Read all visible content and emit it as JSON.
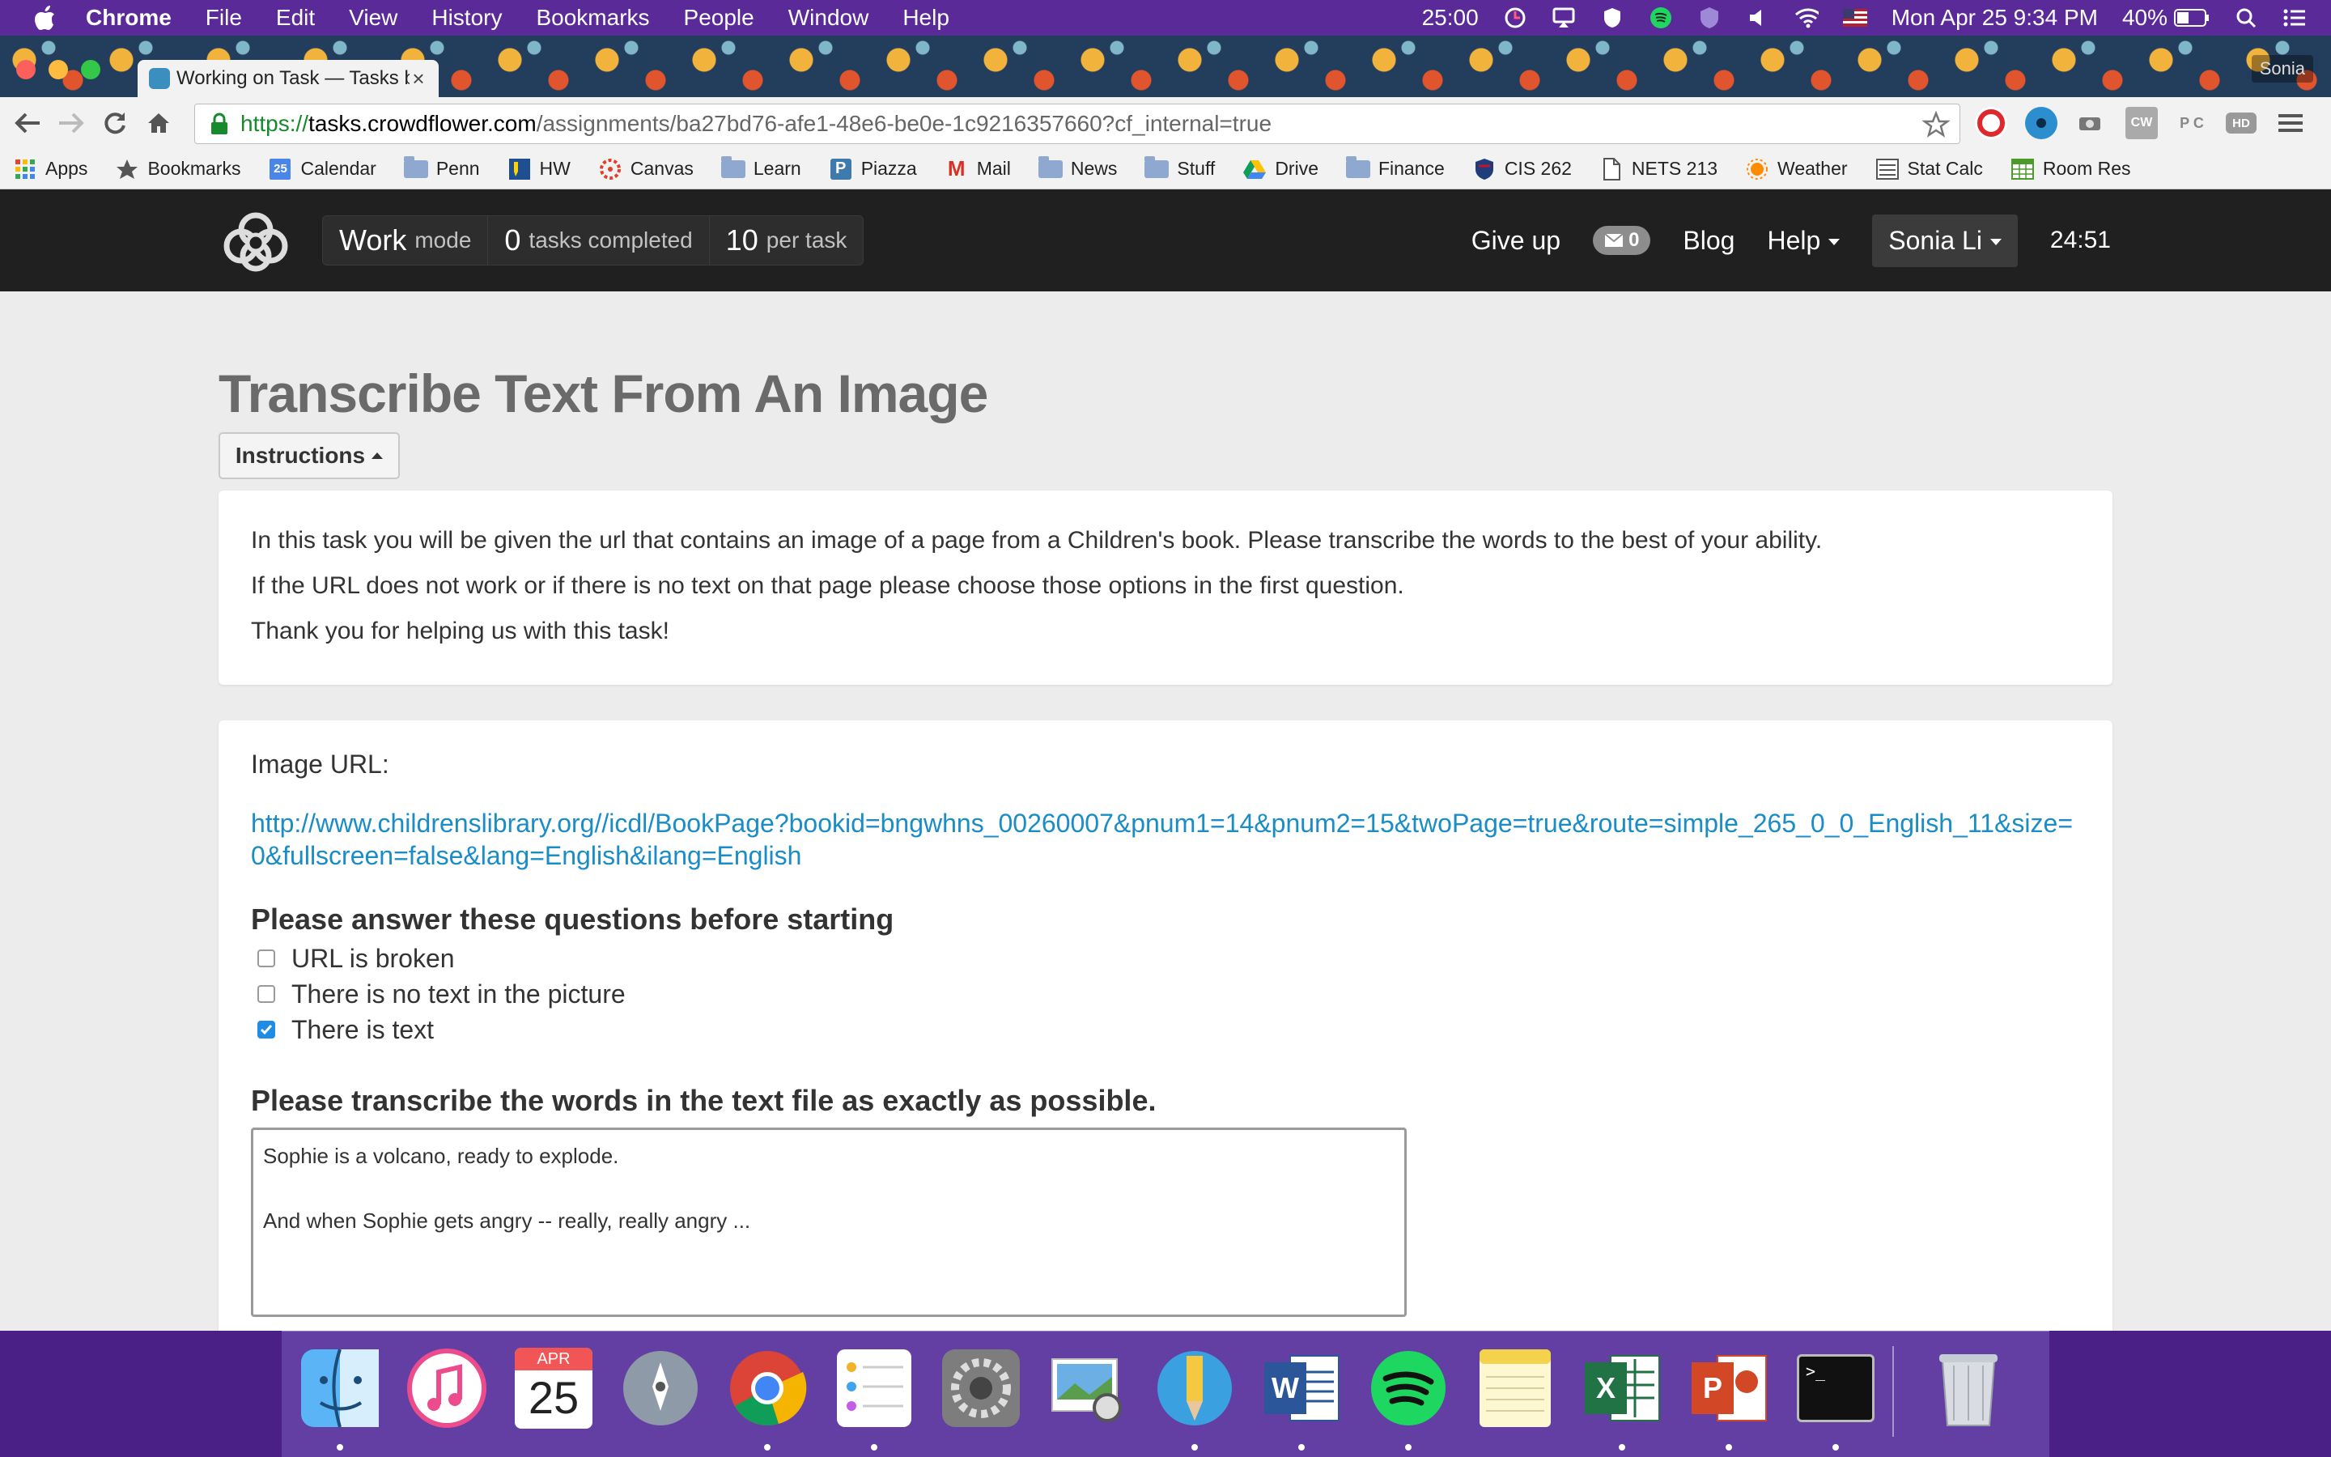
{
  "menubar": {
    "app": "Chrome",
    "items": [
      "File",
      "Edit",
      "View",
      "History",
      "Bookmarks",
      "People",
      "Window",
      "Help"
    ],
    "timer": "25:00",
    "datetime": "Mon Apr 25  9:34 PM",
    "battery": "40%"
  },
  "browser": {
    "tab_title": "Working on Task — Tasks b",
    "profile": "Sonia",
    "url_scheme": "https://",
    "url_host": "tasks.crowdflower.com",
    "url_path": "/assignments/ba27bd76-afe1-48e6-be0e-1c9216357660?cf_internal=true",
    "extensions": [
      "opera-icon",
      "eye-icon",
      "camera-icon",
      "cw-icon",
      "pc-icon",
      "hd-icon",
      "menu-icon"
    ],
    "ext_labels": {
      "cw": "CW",
      "pc": "P C",
      "hd": "HD"
    }
  },
  "bookmarks": [
    {
      "label": "Apps",
      "icon": "apps-grid-icon"
    },
    {
      "label": "Bookmarks",
      "icon": "star-icon"
    },
    {
      "label": "Calendar",
      "icon": "calendar-icon",
      "day": "25"
    },
    {
      "label": "Penn",
      "icon": "folder-icon"
    },
    {
      "label": "HW",
      "icon": "hw-icon"
    },
    {
      "label": "Canvas",
      "icon": "canvas-icon"
    },
    {
      "label": "Learn",
      "icon": "folder-icon"
    },
    {
      "label": "Piazza",
      "icon": "piazza-icon",
      "glyph": "P"
    },
    {
      "label": "Mail",
      "icon": "gmail-icon",
      "glyph": "M"
    },
    {
      "label": "News",
      "icon": "folder-icon"
    },
    {
      "label": "Stuff",
      "icon": "folder-icon"
    },
    {
      "label": "Drive",
      "icon": "drive-icon"
    },
    {
      "label": "Finance",
      "icon": "folder-icon"
    },
    {
      "label": "CIS 262",
      "icon": "shield-icon"
    },
    {
      "label": "NETS 213",
      "icon": "document-icon"
    },
    {
      "label": "Weather",
      "icon": "sun-icon"
    },
    {
      "label": "Stat Calc",
      "icon": "calculator-icon"
    },
    {
      "label": "Room Res",
      "icon": "calendar-grid-icon"
    }
  ],
  "header": {
    "mode_word": "Work",
    "mode_label": "mode",
    "tasks_count": "0",
    "tasks_label": "tasks completed",
    "per_task_count": "10",
    "per_task_label": "per task",
    "give_up": "Give up",
    "messages": "0",
    "blog": "Blog",
    "help": "Help",
    "user": "Sonia Li",
    "timer": "24:51"
  },
  "main": {
    "title": "Transcribe Text From An Image",
    "instructions_button": "Instructions",
    "instructions": [
      "In this task you will be given the url that contains an image of a page from a Children's book. Please transcribe the words to the best of your ability.",
      "If the URL does not work or if there is no text on that page please choose those options in the first question.",
      "Thank you for helping us with this task!"
    ],
    "image_url_label": "Image URL:",
    "image_url": "http://www.childrenslibrary.org//icdl/BookPage?bookid=bngwhns_00260007&pnum1=14&pnum2=15&twoPage=true&route=simple_265_0_0_English_11&size=0&fullscreen=false&lang=English&ilang=English",
    "question1": "Please answer these questions before starting",
    "options": [
      {
        "label": "URL is broken",
        "checked": false
      },
      {
        "label": "There is no text in the picture",
        "checked": false
      },
      {
        "label": "There is text",
        "checked": true
      }
    ],
    "question2": "Please transcribe the words in the text file as exactly as possible.",
    "transcription": "Sophie is a volcano, ready to explode.\n\nAnd when Sophie gets angry -- really, really angry ..."
  },
  "dock": {
    "apps": [
      "finder-icon",
      "itunes-icon",
      "calendar-icon",
      "launchpad-icon",
      "chrome-icon",
      "reminders-icon",
      "system-preferences-icon",
      "preview-icon",
      "pencil-app-icon",
      "word-icon",
      "spotify-icon",
      "notes-icon",
      "excel-icon",
      "powerpoint-icon",
      "terminal-icon",
      "trash-icon"
    ],
    "calendar_month": "APR",
    "calendar_day": "25",
    "terminal_prompt": ">_"
  },
  "colors": {
    "menubar_bg": "#5b2a99",
    "site_header_bg": "#202020",
    "link": "#1a8cc6",
    "checkbox_checked": "#1f8ce6",
    "title_gray": "#6a6a6a"
  }
}
